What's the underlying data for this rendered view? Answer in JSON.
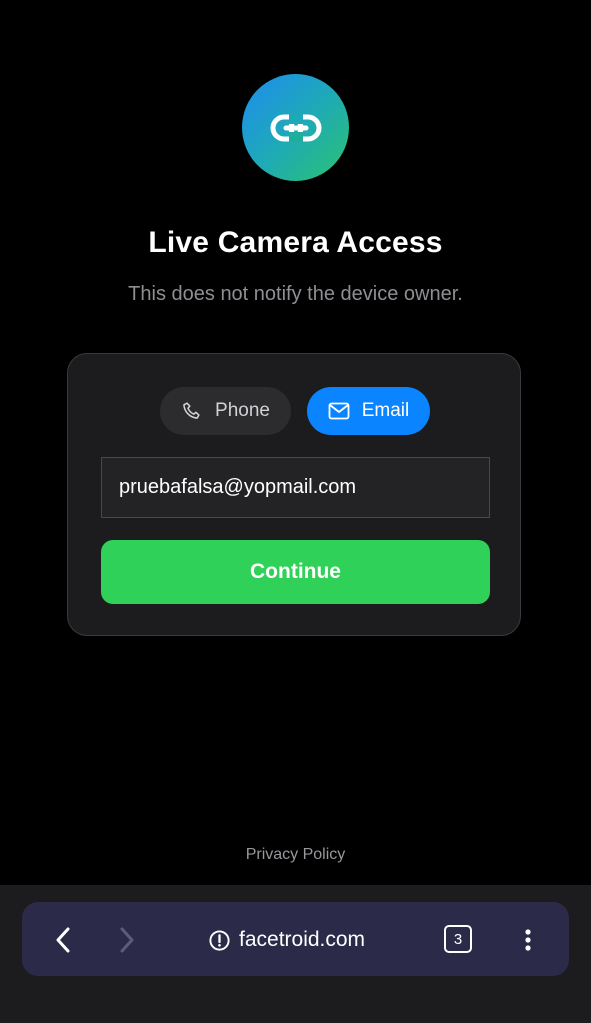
{
  "header": {
    "logo_icon": "link-icon",
    "title": "Live Camera Access",
    "subtitle": "This does not notify the device owner."
  },
  "form": {
    "tabs": [
      {
        "label": "Phone",
        "icon": "phone-icon",
        "selected": false
      },
      {
        "label": "Email",
        "icon": "mail-icon",
        "selected": true
      }
    ],
    "email_value": "pruebafalsa@yopmail.com",
    "continue_label": "Continue"
  },
  "footer": {
    "privacy_label": "Privacy Policy"
  },
  "browser": {
    "url": "facetroid.com",
    "tab_count": "3",
    "icons": [
      "back-icon",
      "forward-icon",
      "info-icon",
      "tabs-icon",
      "menu-icon"
    ]
  },
  "colors": {
    "background": "#000000",
    "card": "#1c1c1e",
    "accent_blue": "#0a84ff",
    "accent_green": "#30d158",
    "browser_bar": "#2b2a48"
  }
}
